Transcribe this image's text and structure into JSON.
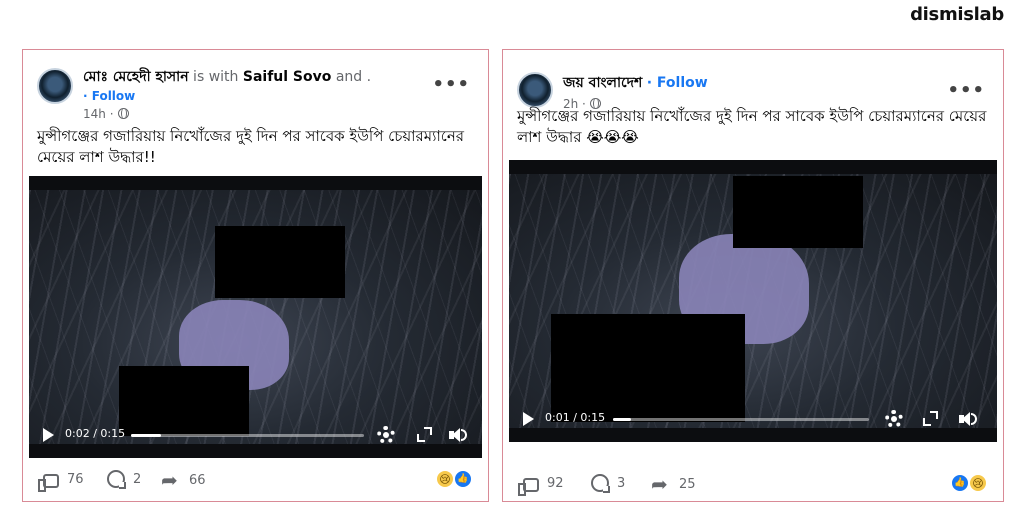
{
  "brand": {
    "logo_text": "dismislab"
  },
  "posts": [
    {
      "author": "মোঃ মেহেদী হাসান",
      "with_text": " is with ",
      "tagged": "Saiful Sovo",
      "and_text": " and .",
      "follow_line": "· Follow",
      "time": "14h ·",
      "caption": "মুন্সীগঞ্জের গজারিয়ায় নিখোঁজের দুই দিন পর সাবেক ইউপি চেয়ারম্যানের মেয়ের লাশ উদ্ধার!!",
      "video": {
        "time": "0:02 / 0:15",
        "progress": 0.13
      },
      "likes": "76",
      "comments": "2",
      "shares": "66",
      "reactions": [
        "sad-reaction",
        "like-reaction"
      ]
    },
    {
      "author": "জয় বাংলাদেশ",
      "follow_inline": "· Follow",
      "time": "2h ·",
      "caption": "মুন্সীগঞ্জের গজারিয়ায় নিখোঁজের দুই দিন পর সাবেক ইউপি চেয়ারম্যানের মেয়ের লাশ উদ্ধার 😭😭😭",
      "video": {
        "time": "0:01 / 0:15",
        "progress": 0.07
      },
      "likes": "92",
      "comments": "3",
      "shares": "25",
      "reactions": [
        "like-reaction",
        "sad-reaction"
      ]
    }
  ],
  "colors": {
    "accent": "#1877f2",
    "frame": "#d98a96",
    "muted": "#65676b"
  }
}
